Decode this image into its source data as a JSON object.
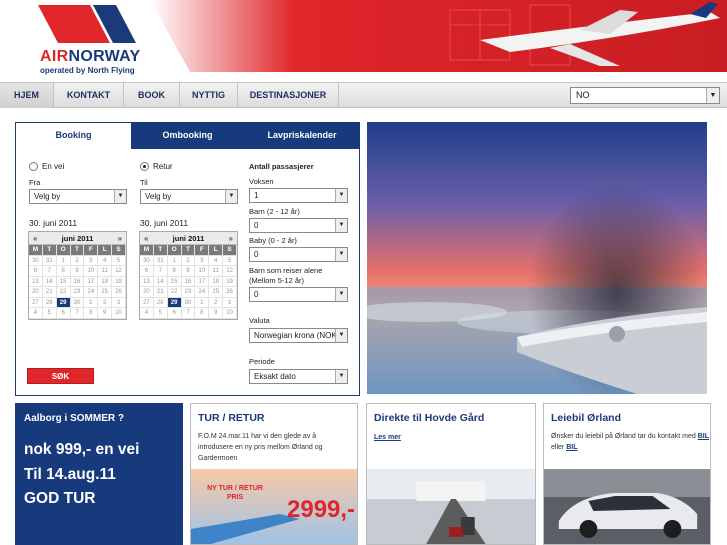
{
  "brand": {
    "air": "AIR",
    "norway": "NORWAY",
    "subline": "operated by North Flying",
    "red": "#e0262b",
    "blue": "#163a7c"
  },
  "nav": {
    "items": [
      {
        "label": "HJEM"
      },
      {
        "label": "KONTAKT"
      },
      {
        "label": "BOOK"
      },
      {
        "label": "NYTTIG"
      },
      {
        "label": "DESTINASJONER"
      }
    ],
    "language": "NO"
  },
  "booking": {
    "tabs": [
      {
        "label": "Booking"
      },
      {
        "label": "Ombooking"
      },
      {
        "label": "Lavpriskalender"
      }
    ],
    "one_way_label": "En vei",
    "return_label": "Retur",
    "from_label": "Fra",
    "to_label": "Til",
    "from_value": "Velg by",
    "to_value": "Velg by",
    "depart_date": "30. juni 2011",
    "return_date": "30. juni 2011",
    "calendar": {
      "month": "juni 2011",
      "prev": "«",
      "next": "»",
      "day_headers": [
        "M",
        "T",
        "O",
        "T",
        "F",
        "L",
        "S"
      ],
      "days": [
        "30",
        "31",
        "1",
        "2",
        "3",
        "4",
        "5",
        "6",
        "7",
        "8",
        "9",
        "10",
        "11",
        "12",
        "13",
        "14",
        "15",
        "16",
        "17",
        "18",
        "19",
        "20",
        "21",
        "22",
        "23",
        "24",
        "25",
        "26",
        "27",
        "28",
        "29",
        "30",
        "1",
        "2",
        "3",
        "4",
        "5",
        "6",
        "7",
        "8",
        "9",
        "10"
      ],
      "selected": "30"
    },
    "passengers_label": "Antall passasjerer",
    "adults_label": "Voksen",
    "adults_value": "1",
    "children_label": "Barn (2 - 12 år)",
    "children_value": "0",
    "baby_label": "Baby (0 - 2 år)",
    "baby_value": "0",
    "unaccompanied_label_1": "Barn som reiser alene",
    "unaccompanied_label_2": "(Mellom 5-12 år)",
    "unaccompanied_value": "0",
    "currency_label": "Valuta",
    "currency_value": "Norwegian krona (NOK)",
    "period_label": "Periode",
    "period_value": "Eksakt dato",
    "search_button": "SØK"
  },
  "promos": {
    "aalborg": {
      "title": "Aalborg i SOMMER ?",
      "line1": "nok 999,- en vei",
      "line2": "Til 14.aug.11",
      "line3": "GOD TUR"
    },
    "tur_retur": {
      "title": "TUR / RETUR",
      "body": "F.O.M 24.mar.11 har vi den glede av å introdusere en ny pris mellom Ørland og Gardermoen",
      "tag_line1": "NY TUR / RETUR",
      "tag_line2": "PRIS",
      "price": "2999,-"
    },
    "hovde": {
      "title": "Direkte til Hovde Gård",
      "link": "Les mer"
    },
    "leiebil": {
      "title": "Leiebil Ørland",
      "body_prefix": "Ønsker du leiebil på Ørland tar du kontakt med",
      "link1": "BIL",
      "connector": "eller",
      "link2": "BIL"
    }
  }
}
